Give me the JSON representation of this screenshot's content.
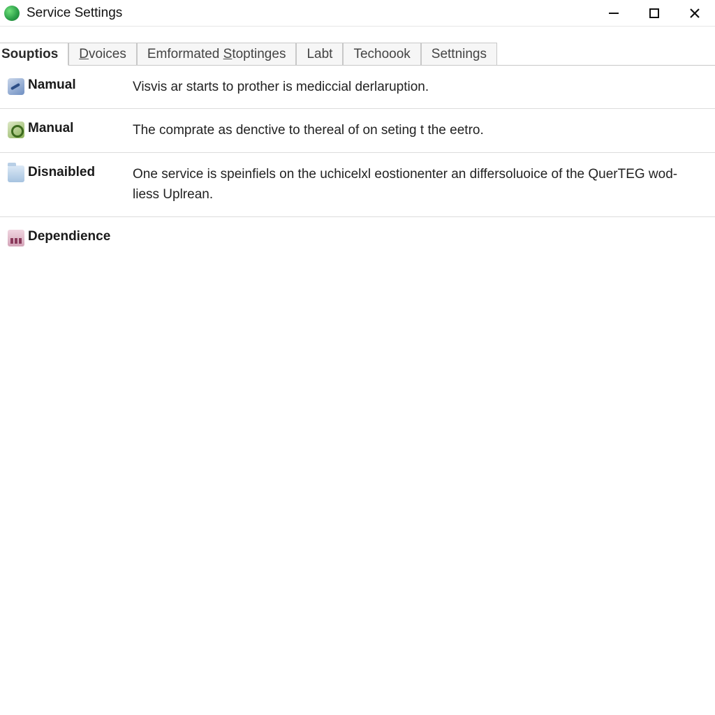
{
  "window": {
    "title": "Service Settings"
  },
  "tabs": [
    {
      "label": "Souptios",
      "active": true
    },
    {
      "label": "Dvoices",
      "active": false,
      "underline_index": 0
    },
    {
      "label": "Emformated Stoptinges",
      "active": false,
      "underline_index": 11
    },
    {
      "label": "Labt",
      "active": false
    },
    {
      "label": "Techoook",
      "active": false
    },
    {
      "label": "Settnings",
      "active": false
    }
  ],
  "rows": [
    {
      "icon": "wrench-icon",
      "label": "Namual",
      "description": "Visvis ar starts to prother is mediccial derlaruption."
    },
    {
      "icon": "gears-icon",
      "label": "Manual",
      "description": "The comprate as denctive to thereal of on seting t the eetro."
    },
    {
      "icon": "folder-icon",
      "label": "Disnaibled",
      "description": "One service is speinfiels on the uchicelxl eostionenter an differsoluoice of the QuerTEG wod-liess Uplrean."
    },
    {
      "icon": "chart-icon",
      "label": "Dependience",
      "description": ""
    }
  ]
}
